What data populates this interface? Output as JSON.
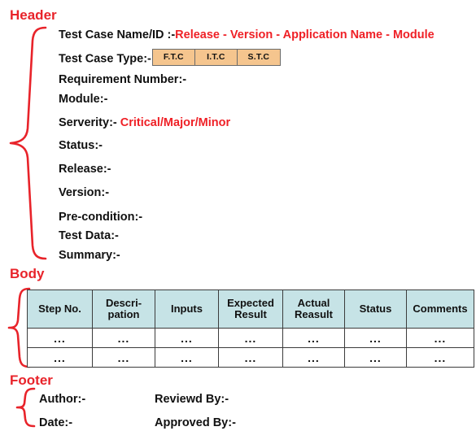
{
  "sections": {
    "header_caption": "Header",
    "body_caption": "Body",
    "footer_caption": "Footer"
  },
  "colors": {
    "accent_red": "#e8232a",
    "value_red": "#ef2026",
    "chip_orange": "#f5c58e",
    "table_header_teal": "#c6e3e6",
    "text_black": "#111111"
  },
  "header": {
    "fields": [
      {
        "label": "Test Case Name/ID :-",
        "value": "Release - Version - Application Name - Module"
      },
      {
        "label": "Test Case Type:-",
        "value": ""
      },
      {
        "label": "Requirement Number:-",
        "value": ""
      },
      {
        "label": "Module:-",
        "value": ""
      },
      {
        "label": "Serverity:-",
        "value": "Critical/Major/Minor"
      },
      {
        "label": "Status:-",
        "value": ""
      },
      {
        "label": "Release:-",
        "value": ""
      },
      {
        "label": "Version:-",
        "value": ""
      },
      {
        "label": "Pre-condition:-",
        "value": ""
      },
      {
        "label": "Test Data:-",
        "value": ""
      },
      {
        "label": "Summary:-",
        "value": ""
      }
    ],
    "test_case_types": [
      "F.T.C",
      "I.T.C",
      "S.T.C"
    ]
  },
  "body": {
    "columns": [
      "Step No.",
      "Descri-pation",
      "Inputs",
      "Expected Result",
      "Actual Reasult",
      "Status",
      "Comments"
    ],
    "columns_wrapped": [
      [
        "Step No."
      ],
      [
        "Descri-",
        "pation"
      ],
      [
        "Inputs"
      ],
      [
        "Expected",
        "Result"
      ],
      [
        "Actual",
        "Reasult"
      ],
      [
        "Status"
      ],
      [
        "Comments"
      ]
    ],
    "rows": [
      [
        "...",
        "...",
        "...",
        "...",
        "...",
        "...",
        "..."
      ],
      [
        "...",
        "...",
        "...",
        "...",
        "...",
        "...",
        "..."
      ]
    ]
  },
  "footer": {
    "author_label": "Author:-",
    "reviewed_by_label": "Reviewd By:-",
    "date_label": "Date:-",
    "approved_by_label": "Approved By:-"
  }
}
